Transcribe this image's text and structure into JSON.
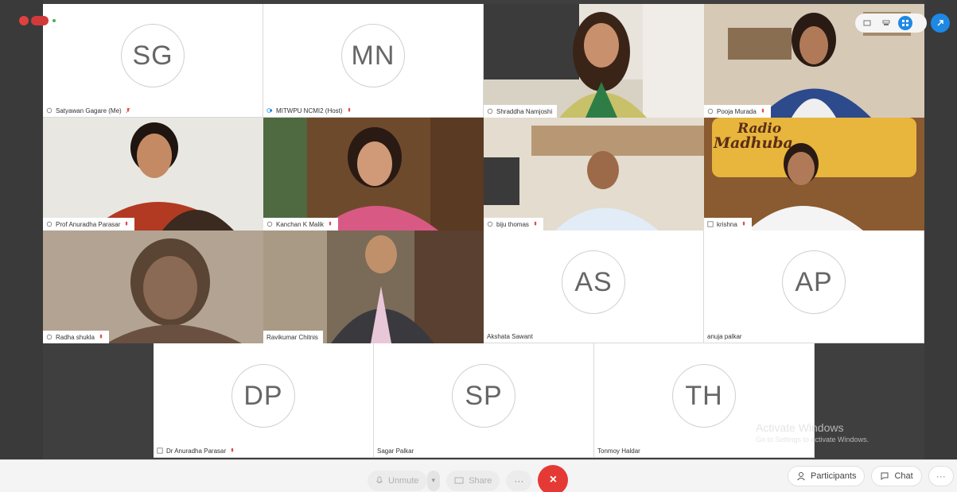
{
  "participants": [
    {
      "name": "Satyawan Gagare (Me)",
      "initials": "SG"
    },
    {
      "name": "MITWPU NCMI2 (Host)",
      "initials": "MN"
    },
    {
      "name": "Shraddha Namjoshi"
    },
    {
      "name": "Pooja Murada"
    },
    {
      "name": "Prof Anuradha Parasar"
    },
    {
      "name": "Kanchan K Malik"
    },
    {
      "name": "biju thomas"
    },
    {
      "name": "krishna"
    },
    {
      "name": "Radha shukla"
    },
    {
      "name": "Ravikumar Chitnis"
    },
    {
      "name": "Akshata Sawant",
      "initials": "AS"
    },
    {
      "name": "anuja palkar",
      "initials": "AP"
    },
    {
      "name": "Dr Anuradha Parasar",
      "initials": "DP"
    },
    {
      "name": "Sagar Palkar",
      "initials": "SP"
    },
    {
      "name": "Tonmoy Haldar",
      "initials": "TH"
    }
  ],
  "background_sign": {
    "line1": "Radio",
    "line2": "Madhuba"
  },
  "toolbar": {
    "unmute_label": "Unmute",
    "share_label": "Share",
    "more_label": "···",
    "end_label": "×",
    "participants_label": "Participants",
    "chat_label": "Chat",
    "overflow_label": "···"
  },
  "watermark": {
    "line1": "Activate Windows",
    "line2": "Go to Settings to activate Windows."
  },
  "colors": {
    "accent": "#1e88e5",
    "end_call": "#e53935",
    "mic_muted": "#e05050"
  }
}
